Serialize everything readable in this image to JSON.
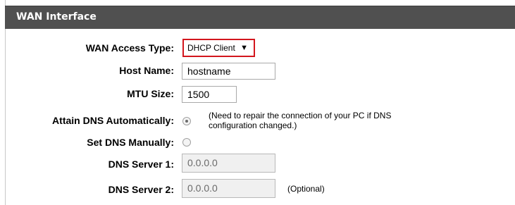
{
  "section": {
    "title": "WAN Interface"
  },
  "wan_access_type": {
    "label": "WAN Access Type:",
    "selected": "DHCP Client"
  },
  "host_name": {
    "label": "Host Name:",
    "value": "hostname"
  },
  "mtu_size": {
    "label": "MTU Size:",
    "value": "1500"
  },
  "attain_dns": {
    "label": "Attain DNS Automatically:",
    "checked": true,
    "note": "(Need to repair the connection of your PC if DNS configuration changed.)"
  },
  "set_dns": {
    "label": "Set DNS Manually:",
    "checked": false
  },
  "dns_server_1": {
    "label": "DNS Server 1:",
    "value": "0.0.0.0"
  },
  "dns_server_2": {
    "label": "DNS Server 2:",
    "value": "0.0.0.0",
    "hint": "(Optional)"
  },
  "colors": {
    "header_bg": "#505050",
    "highlight_border": "#d3161d"
  },
  "icons": {
    "select_caret": "caret-down-icon"
  }
}
